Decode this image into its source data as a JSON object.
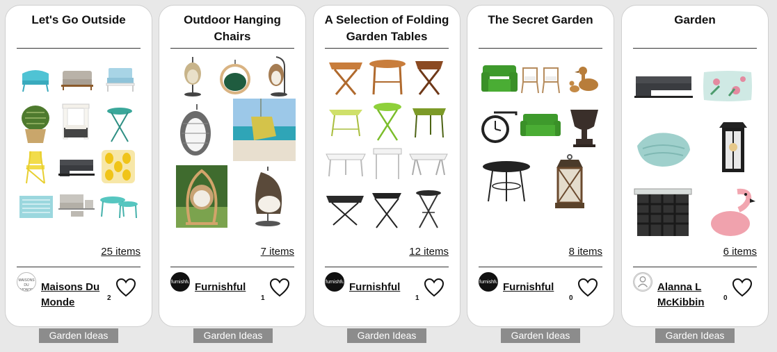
{
  "cards": [
    {
      "title": "Let's Go Outside",
      "items": "25 items",
      "avatar_text": "MAISONS DU MONDE",
      "owner": "Maisons Du Monde",
      "likes": "2",
      "tag": "Garden Ideas",
      "thumbnails": [
        "turquoise-rope-loveseat-image",
        "grey-sofa-image",
        "blue-armchair-image",
        "cactus-pot-image",
        "canopy-daybed-image",
        "teal-bistro-table-image",
        "yellow-folding-chair-image",
        "grey-corner-sofa-image",
        "yellow-pineapple-cushion-image",
        "turquoise-rug-image",
        "outdoor-lounge-set-image",
        "turquoise-coffee-tables-image"
      ]
    },
    {
      "title": "Outdoor Hanging Chairs",
      "items": "7 items",
      "avatar_text": "furnishful",
      "owner": "Furnishful",
      "likes": "1",
      "tag": "Garden Ideas",
      "thumbnails": [
        "wicker-egg-chair-image",
        "green-pod-chair-image",
        "rattan-hanging-chair-image",
        "grey-hanging-cocoon-image",
        "beach-hammock-chair-image",
        "wooden-frame-pod-image",
        "arched-hanging-chair-image"
      ]
    },
    {
      "title": "A Selection of Folding Garden Tables",
      "items": "12 items",
      "avatar_text": "furnishful",
      "owner": "Furnishful",
      "likes": "1",
      "tag": "Garden Ideas",
      "thumbnails": [
        "wood-folding-table-image",
        "round-wood-table-image",
        "dark-wood-folding-table-image",
        "green-metal-table-image",
        "lime-bistro-table-image",
        "olive-camping-table-image",
        "white-folding-table-image",
        "white-metal-table-image",
        "white-trestle-table-image",
        "black-folding-table-image",
        "black-square-bistro-table-image",
        "black-round-bistro-table-image"
      ]
    },
    {
      "title": "The Secret Garden",
      "items": "8 items",
      "avatar_text": "furnishful",
      "owner": "Furnishful",
      "likes": "0",
      "tag": "Garden Ideas",
      "thumbnails": [
        "grass-armchair-image",
        "rattan-chairs-image",
        "duck-ornaments-image",
        "station-clock-image",
        "grass-sofa-image",
        "stone-urn-image",
        "round-iron-table-image",
        "wooden-lantern-image"
      ]
    },
    {
      "title": "Garden",
      "items": "6 items",
      "avatar_text": "",
      "owner": "Alanna L McKibbin",
      "likes": "0",
      "tag": "Garden Ideas",
      "thumbnails": [
        "grey-corner-sofa-image",
        "floral-cushion-image",
        "mint-throw-blanket-image",
        "black-wall-lantern-image",
        "wine-rack-table-image",
        "pink-flamingo-image"
      ]
    }
  ]
}
